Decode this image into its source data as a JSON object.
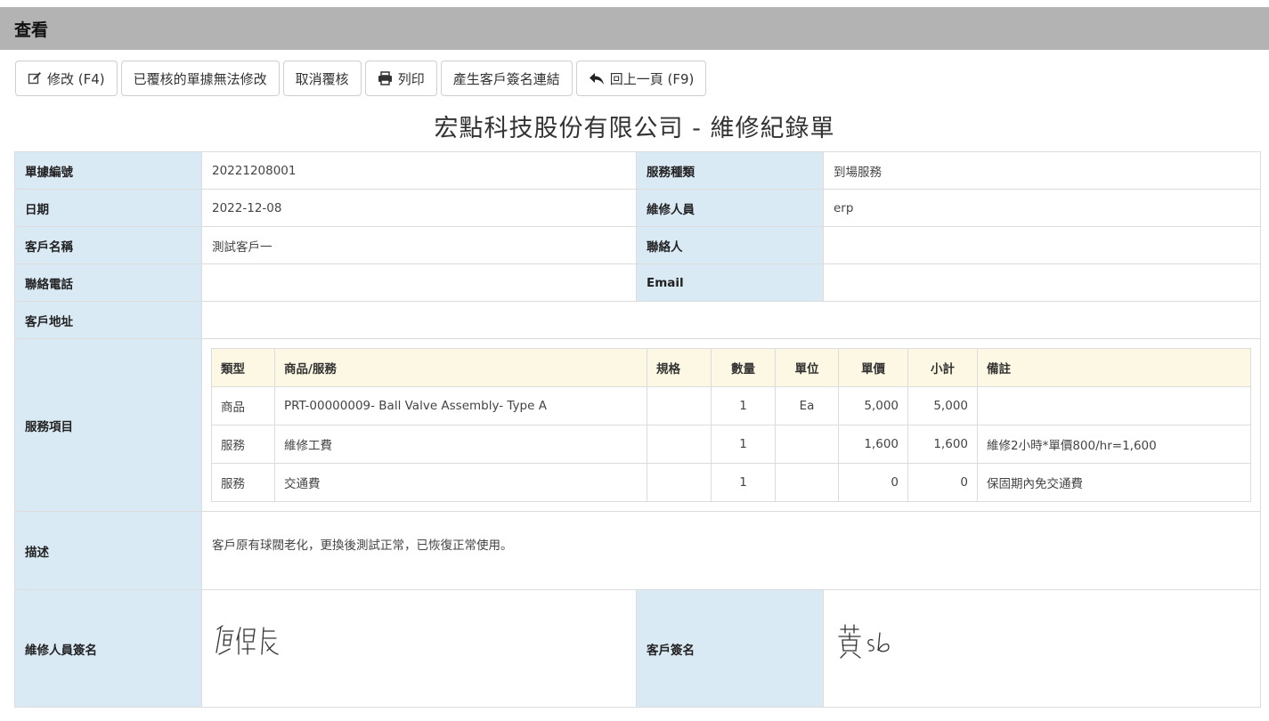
{
  "panel": {
    "title": "查看"
  },
  "toolbar": {
    "edit_label": "修改 (F4)",
    "locked_label": "已覆核的單據無法修改",
    "cancel_review_label": "取消覆核",
    "print_label": "列印",
    "sign_link_label": "產生客戶簽名連結",
    "back_label": "回上一頁 (F9)"
  },
  "document": {
    "title": "宏點科技股份有限公司 - 維修紀錄單"
  },
  "fields": {
    "doc_no": {
      "label": "單據編號",
      "value": "20221208001"
    },
    "service_type": {
      "label": "服務種類",
      "value": "到場服務"
    },
    "date": {
      "label": "日期",
      "value": "2022-12-08"
    },
    "technician": {
      "label": "維修人員",
      "value": "erp"
    },
    "customer_name": {
      "label": "客戶名稱",
      "value": "測試客戶一"
    },
    "contact": {
      "label": "聯絡人",
      "value": ""
    },
    "phone": {
      "label": "聯絡電話",
      "value": ""
    },
    "email": {
      "label": "Email",
      "value": ""
    },
    "address": {
      "label": "客戶地址",
      "value": ""
    },
    "items_label": "服務項目",
    "description": {
      "label": "描述",
      "value": "客戶原有球閥老化，更換後測試正常，已恢復正常使用。"
    },
    "tech_signature": {
      "label": "維修人員簽名"
    },
    "customer_signature": {
      "label": "客戶簽名"
    }
  },
  "items": {
    "headers": {
      "type": "類型",
      "product": "商品/服務",
      "spec": "規格",
      "qty": "數量",
      "unit": "單位",
      "price": "單價",
      "subtotal": "小計",
      "note": "備註"
    },
    "rows": [
      {
        "type": "商品",
        "product": "PRT-00000009- Ball Valve Assembly- Type A",
        "spec": "",
        "qty": "1",
        "unit": "Ea",
        "price": "5,000",
        "subtotal": "5,000",
        "note": ""
      },
      {
        "type": "服務",
        "product": "維修工費",
        "spec": "",
        "qty": "1",
        "unit": "",
        "price": "1,600",
        "subtotal": "1,600",
        "note": "維修2小時*單價800/hr=1,600"
      },
      {
        "type": "服務",
        "product": "交通費",
        "spec": "",
        "qty": "1",
        "unit": "",
        "price": "0",
        "subtotal": "0",
        "note": "保固期內免交通費"
      }
    ]
  },
  "icons": {
    "edit": "edit-icon",
    "print": "print-icon",
    "back": "reply-icon"
  }
}
